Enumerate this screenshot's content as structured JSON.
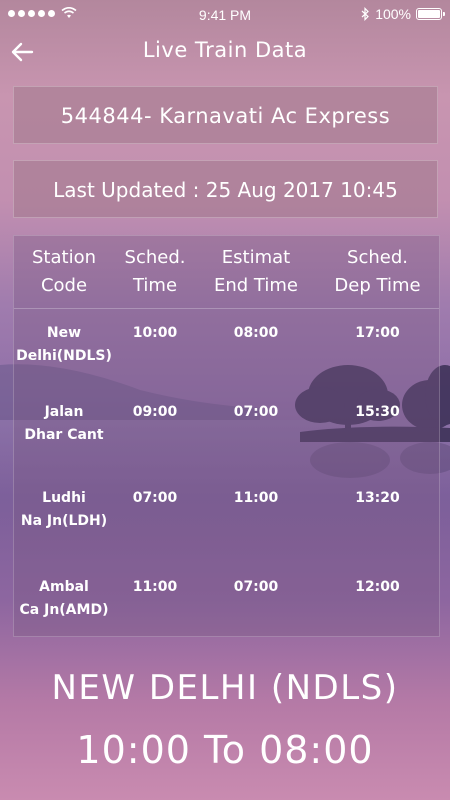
{
  "status_bar": {
    "carrier_dots": 5,
    "time": "9:41 PM",
    "battery": "100%"
  },
  "nav": {
    "title": "Live Train Data"
  },
  "train": {
    "name": "544844- Karnavati Ac Express"
  },
  "updated": {
    "text": "Last Updated : 25 Aug 2017 10:45"
  },
  "table": {
    "headers": {
      "station": [
        "Station",
        "Code"
      ],
      "sched_time": [
        "Sched.",
        "Time"
      ],
      "estimated_end": [
        "Estimat",
        "End Time"
      ],
      "sched_dep": [
        "Sched.",
        "Dep Time"
      ]
    },
    "rows": [
      {
        "station": [
          "New",
          "Delhi(NDLS)"
        ],
        "sched": "10:00",
        "est_end": "08:00",
        "dep": "17:00"
      },
      {
        "station": [
          "Jalan",
          "Dhar Cant"
        ],
        "sched": "09:00",
        "est_end": "07:00",
        "dep": "15:30"
      },
      {
        "station": [
          "Ludhi",
          "Na Jn(LDH)"
        ],
        "sched": "07:00",
        "est_end": "11:00",
        "dep": "13:20"
      },
      {
        "station": [
          "Ambal",
          "Ca Jn(AMD)"
        ],
        "sched": "11:00",
        "est_end": "07:00",
        "dep": "12:00"
      }
    ]
  },
  "summary": {
    "station": "NEW DELHI (NDLS)",
    "times": "10:00 To 08:00"
  }
}
